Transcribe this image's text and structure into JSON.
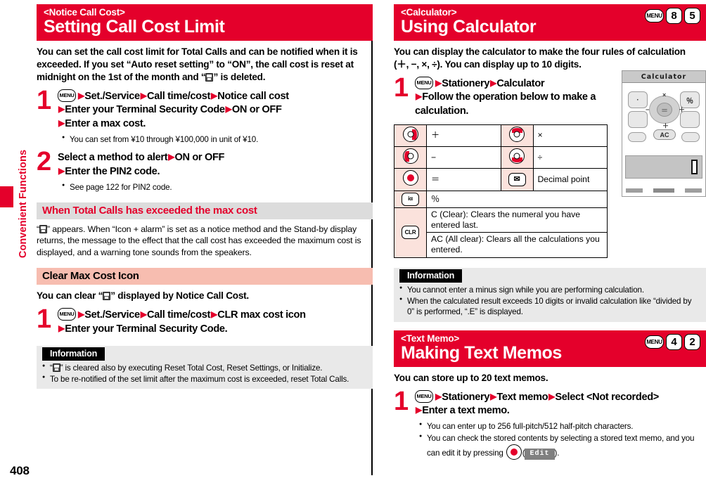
{
  "sidebar": {
    "tab_label": "Convenient Functions",
    "page_number": "408"
  },
  "left_column": {
    "banner": {
      "sub": "<Notice Call Cost>",
      "title": "Setting Call Cost Limit"
    },
    "lead_part1": "You can set the call cost limit for Total Calls and can be notified when it is exceeded. If you set “Auto reset setting” to “ON”, the call cost is reset at midnight on the 1st of the month and “",
    "lead_part2": "” is deleted.",
    "step1": {
      "number": "1",
      "menu_key": "MENU",
      "line1_a": "Set./Service",
      "line1_b": "Call time/cost",
      "line1_c": "Notice call cost",
      "line2_a": "Enter your Terminal Security Code",
      "line2_b": "ON or OFF",
      "line3_a": "Enter a max cost.",
      "bullets": [
        "You can set from ¥10 through ¥100,000 in unit of ¥10."
      ]
    },
    "step2": {
      "number": "2",
      "line1_a": "Select a method to alert",
      "line1_b": "ON or OFF",
      "line2_a": "Enter the PIN2 code.",
      "bullets": [
        "See page 122 for PIN2 code."
      ]
    },
    "section_exceeded": {
      "heading": "When Total Calls has exceeded the max cost",
      "body_part1": "“",
      "body_part2": "” appears. When “Icon + alarm” is set as a notice method and the Stand-by display returns, the message to the effect that the call cost has exceeded the maximum cost is displayed, and a warning tone sounds from the speakers."
    },
    "section_clear": {
      "heading": "Clear Max Cost Icon",
      "lead_part1": "You can clear “",
      "lead_part2": "” displayed by Notice Call Cost.",
      "step1": {
        "number": "1",
        "menu_key": "MENU",
        "line1_a": "Set./Service",
        "line1_b": "Call time/cost",
        "line1_c": "CLR max cost icon",
        "line2_a": "Enter your Terminal Security Code."
      }
    },
    "information": {
      "title": "Information",
      "item1_part1": "“",
      "item1_part2": "” is cleared also by executing Reset Total Cost, Reset Settings, or Initialize.",
      "item2": "To be re-notified of the set limit after the maximum cost is exceeded, reset Total Calls."
    }
  },
  "right_column": {
    "calculator": {
      "banner": {
        "sub": "<Calculator>",
        "title": "Using Calculator",
        "keys": [
          "MENU",
          "8",
          "5"
        ]
      },
      "lead": "You can display the calculator to make the four rules of calculation (＋, −, ×, ÷). You can display up to 10 digits.",
      "step1": {
        "number": "1",
        "menu_key": "MENU",
        "line1_a": "Stationery",
        "line1_b": "Calculator",
        "line2_a": "Follow the operation below to make a",
        "line3_a": "calculation."
      },
      "key_table": [
        {
          "left_icon": "navi-right-key-icon",
          "left_value": "＋",
          "right_icon": "navi-up-key-icon",
          "right_value": "×"
        },
        {
          "left_icon": "navi-left-key-icon",
          "left_value": "−",
          "right_icon": "navi-down-key-icon",
          "right_value": "÷"
        },
        {
          "left_icon": "navi-center-key-icon",
          "left_value": "＝",
          "right_icon": "mail-key-icon",
          "right_value": "Decimal point"
        }
      ],
      "key_table_extra": [
        {
          "icon": "i-mode-key-icon",
          "icon_label": "iα",
          "value": "％"
        },
        {
          "icon": "clr-key-icon",
          "icon_label": "CLR",
          "value": "C (Clear): Clears the numeral you have entered last."
        },
        {
          "icon": "",
          "icon_label": "",
          "value": "AC (All clear): Clears all the calculations you entered."
        }
      ],
      "phone_shot": {
        "title": "Calculator",
        "btn_dot": "·",
        "btn_percent": "％",
        "center_symbol": "＝",
        "sym_up": "×",
        "sym_down": "＋",
        "sym_left": "−",
        "sym_right": "＋",
        "ac_label": "AC"
      },
      "information": {
        "title": "Information",
        "items": [
          "You cannot enter a minus sign while you are performing calculation.",
          "When the calculated result exceeds 10 digits or invalid calculation like “divided by 0” is performed, “.E” is displayed."
        ]
      }
    },
    "text_memo": {
      "banner": {
        "sub": "<Text Memo>",
        "title": "Making Text Memos",
        "keys": [
          "MENU",
          "4",
          "2"
        ]
      },
      "lead": "You can store up to 20 text memos.",
      "step1": {
        "number": "1",
        "menu_key": "MENU",
        "line1_a": "Stationery",
        "line1_b": "Text memo",
        "line1_c": "Select <Not recorded>",
        "line2_a": "Enter a text memo."
      },
      "bullets": {
        "item1": "You can enter up to 256 full-pitch/512 half-pitch characters.",
        "item2_part1": "You can check the stored contents by selecting a stored text memo, and you can edit it by pressing ",
        "item2_softkey": "Edit",
        "item2_part2": ")."
      }
    }
  },
  "colors": {
    "brand_red": "#e4002b",
    "subhead_grey": "#dcdcdc",
    "subhead_pink": "#f7bdb0",
    "info_bg": "#e9e9e9",
    "key_cell_pink": "#fbe2dc"
  }
}
